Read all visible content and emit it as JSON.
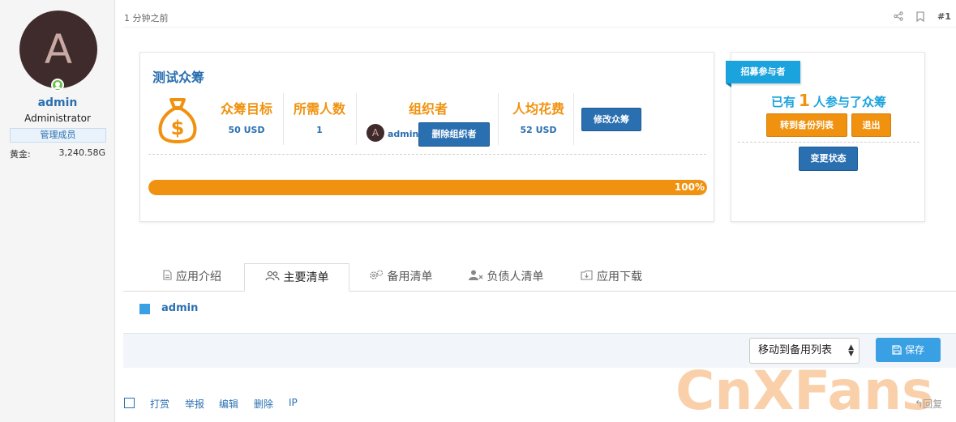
{
  "user": {
    "avatar_letter": "A",
    "name": "admin",
    "role": "Administrator",
    "group_badge": "管理成员",
    "gold_label": "黄金:",
    "gold_value": "3,240.58G"
  },
  "post": {
    "time": "1 分钟之前",
    "number": "#1"
  },
  "crowdfund": {
    "title": "测试众筹",
    "goal_label": "众筹目标",
    "goal_value": "50 USD",
    "people_label": "所需人数",
    "people_value": "1",
    "organizer_label": "组织者",
    "organizer_avatar": "A",
    "organizer_name": "admin",
    "remove_organizer_button": "删除组织者",
    "per_person_label": "人均花费",
    "per_person_value": "52 USD",
    "edit_button": "修改众筹",
    "progress_percent": 100,
    "progress_text": "100%"
  },
  "participants": {
    "ribbon": "招募参与者",
    "prefix": "已有",
    "count": "1",
    "suffix": "人参与了众筹",
    "to_backup_button": "转到备份列表",
    "exit_button": "退出",
    "change_status_button": "变更状态"
  },
  "tabs": [
    {
      "label": "应用介绍",
      "icon": "document-icon"
    },
    {
      "label": "主要清单",
      "icon": "users-icon"
    },
    {
      "label": "备用清单",
      "icon": "gears-icon"
    },
    {
      "label": "负债人清单",
      "icon": "user-x-icon"
    },
    {
      "label": "应用下载",
      "icon": "download-icon"
    }
  ],
  "list": {
    "items": [
      "admin"
    ]
  },
  "actions": {
    "move_select_value": "移动到备用列表",
    "save_button": "保存"
  },
  "footer": {
    "links": [
      "打赏",
      "举报",
      "编辑",
      "删除",
      "IP"
    ],
    "reply": "回复"
  },
  "watermark": "CnXFans",
  "colors": {
    "accent_blue": "#2a6fb0",
    "accent_orange": "#f0920f",
    "ribbon_cyan": "#1ba3dd",
    "save_blue": "#3aa0e4"
  }
}
